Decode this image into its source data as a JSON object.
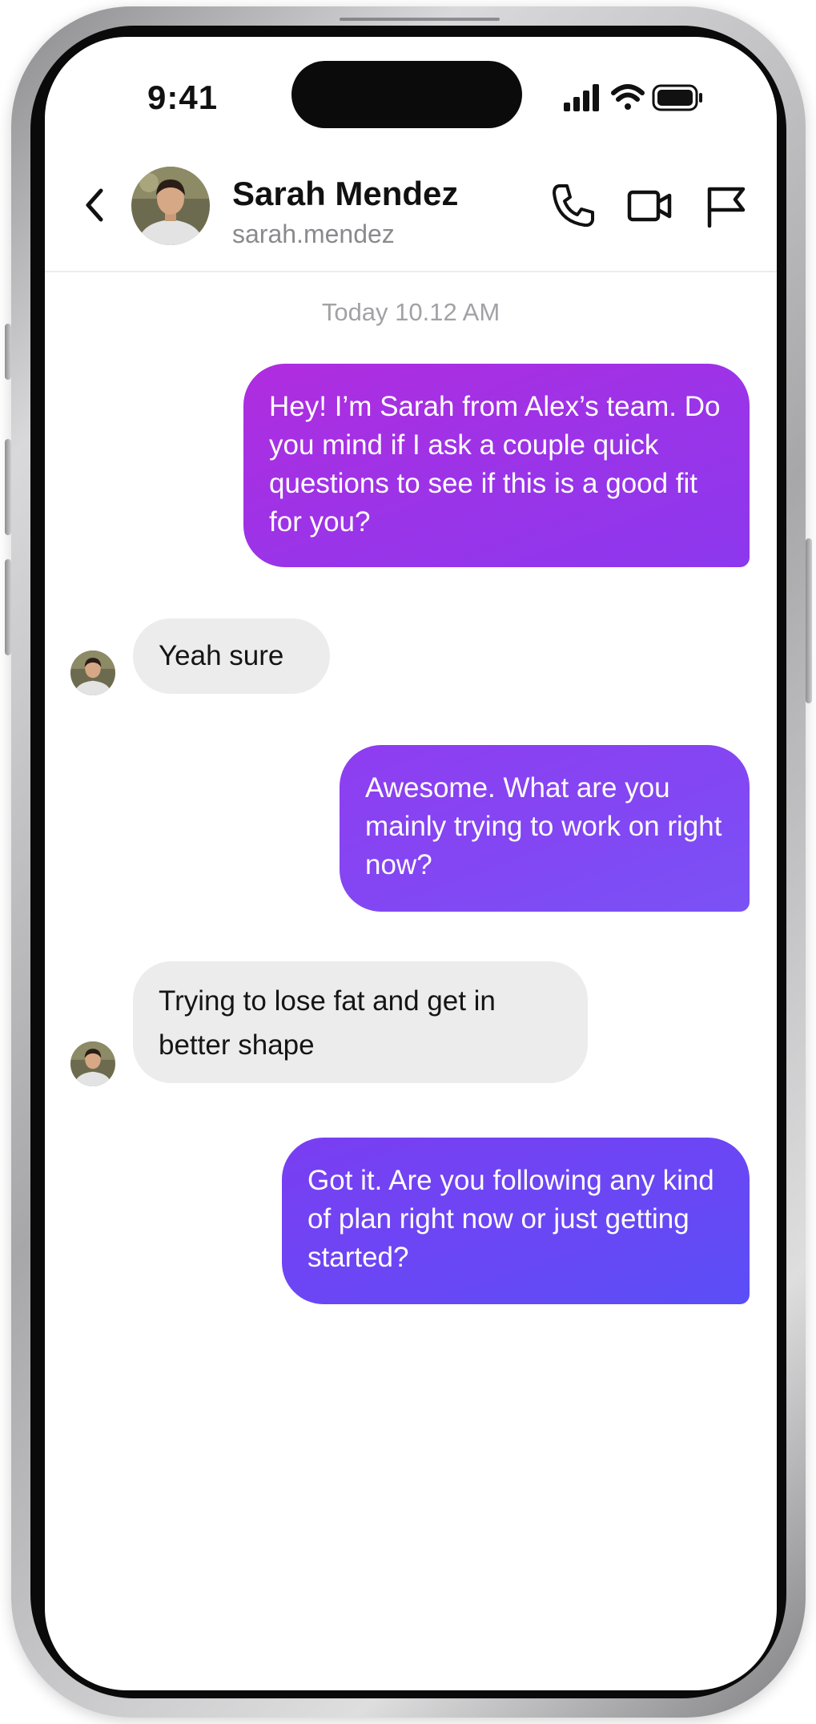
{
  "status_bar": {
    "time": "9:41"
  },
  "header": {
    "contact_name": "Sarah Mendez",
    "contact_handle": "sarah.mendez",
    "icons": [
      "back-chevron-icon",
      "phone-icon",
      "video-camera-icon",
      "flag-icon"
    ]
  },
  "conversation": {
    "timestamp": "Today 10.12 AM",
    "messages": [
      {
        "direction": "outgoing",
        "text": "Hey! I’m Sarah from Alex’s team. Do you mind if I ask a couple quick questions to see if this is a good fit for you?"
      },
      {
        "direction": "incoming",
        "text": "Yeah sure"
      },
      {
        "direction": "outgoing",
        "text": "Awesome. What are you mainly trying to work on right now?"
      },
      {
        "direction": "incoming",
        "text": "Trying to lose fat and get in better shape"
      },
      {
        "direction": "outgoing",
        "text": "Got it. Are you following any kind of plan right now or just getting started?"
      }
    ]
  },
  "colors": {
    "outgoing_gradient_start": "#b12cdf",
    "outgoing_gradient_mid": "#8a3ff0",
    "outgoing_gradient_end": "#5a4ef6",
    "incoming_bubble": "#ececec",
    "timestamp_text": "#a2a2a6"
  }
}
